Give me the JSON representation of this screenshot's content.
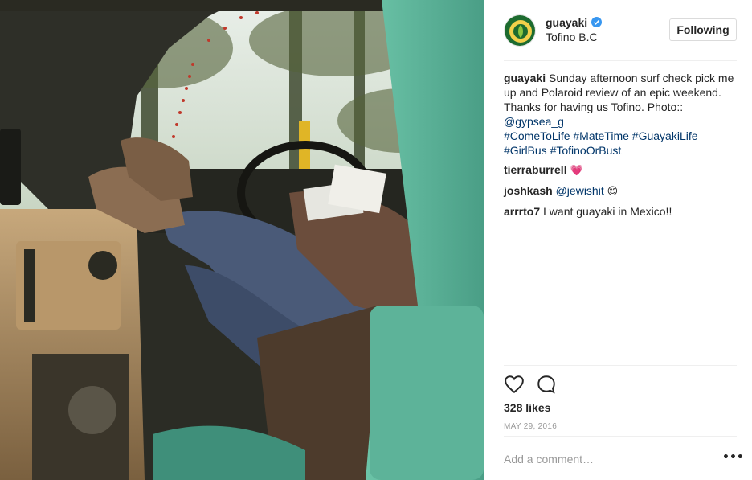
{
  "post": {
    "username": "guayaki",
    "location": "Tofino B.C",
    "follow_label": "Following",
    "caption_user": "guayaki",
    "caption_text": "Sunday afternoon surf check pick me up and Polaroid review of an epic weekend. Thanks for having us Tofino. Photo:: ",
    "caption_mention": "@gypsea_g",
    "caption_tags": [
      "#ComeToLife",
      "#MateTime",
      "#GuayakiLife",
      "#GirlBus",
      "#TofinoOrBust"
    ]
  },
  "comments": [
    {
      "user": "tierraburrell",
      "text": "",
      "mention": "",
      "emoji": "💗"
    },
    {
      "user": "joshkash",
      "text": "",
      "mention": "@jewishit",
      "emoji": "😊"
    },
    {
      "user": "arrrto7",
      "text": "I want guayaki in Mexico!!",
      "mention": "",
      "emoji": ""
    }
  ],
  "actions": {
    "likes": "328 likes",
    "date": "MAY 29, 2016",
    "like_icon": "heart-icon",
    "comment_icon": "speech-bubble-icon"
  },
  "add_comment": {
    "placeholder": "Add a comment…",
    "more_icon": "ellipsis-icon",
    "more_glyph": "•••"
  },
  "colors": {
    "link": "#003569",
    "verified": "#3897f0",
    "van_teal": "#5fb89e"
  }
}
